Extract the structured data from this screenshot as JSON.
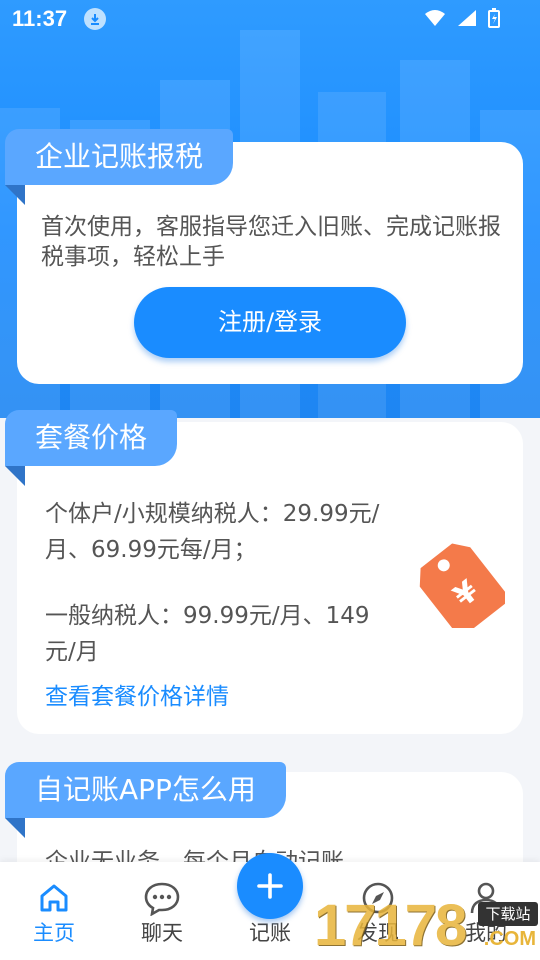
{
  "status": {
    "time": "11:37"
  },
  "card1": {
    "title": "企业记账报税",
    "description": "首次使用，客服指导您迁入旧账、完成记账报税事项，轻松上手",
    "button": "注册/登录"
  },
  "card2": {
    "title": "套餐价格",
    "line1": "个体户/小规模纳税人：29.99元/月、69.99元每/月；",
    "line2": "一般纳税人：99.99元/月、149元/月",
    "link": "查看套餐价格详情"
  },
  "card3": {
    "title": "自记账APP怎么用",
    "text": "企业无业务，每个月自动记账"
  },
  "nav": {
    "items": [
      {
        "label": "主页",
        "icon": "home-icon"
      },
      {
        "label": "聊天",
        "icon": "chat-icon"
      },
      {
        "label": "记账",
        "icon": "plus-icon"
      },
      {
        "label": "发现",
        "icon": "compass-icon"
      },
      {
        "label": "我的",
        "icon": "user-icon"
      }
    ]
  },
  "watermark": {
    "number": "17178",
    "badge": "下载站",
    "suffix": ".COM"
  },
  "colors": {
    "primary": "#1a8cff",
    "tab": "#5aa7ff",
    "tag": "#f47a4a"
  }
}
